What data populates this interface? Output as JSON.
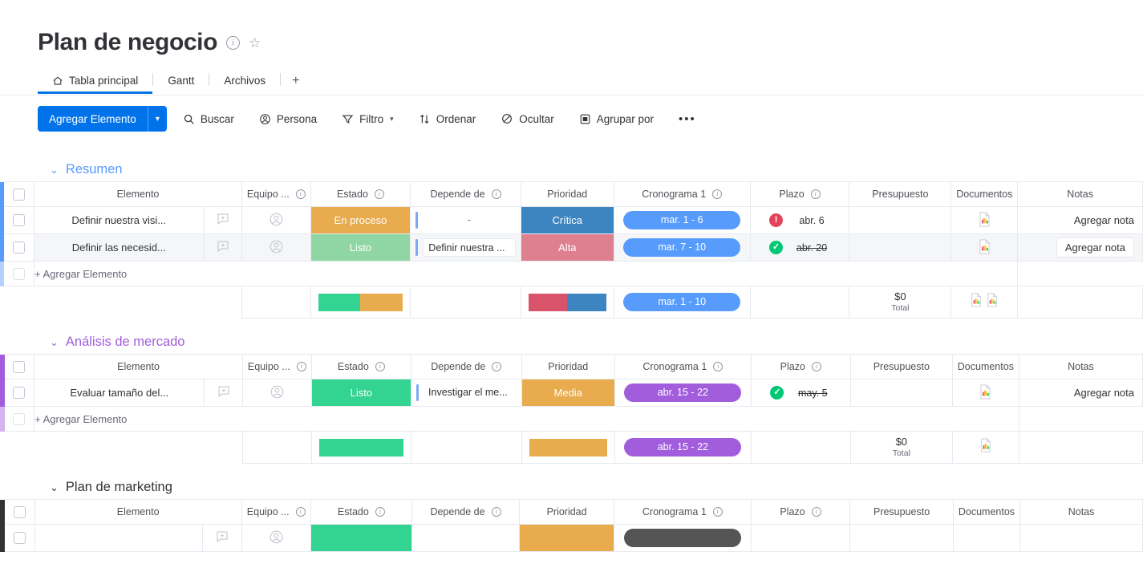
{
  "header": {
    "title": "Plan de negocio",
    "info_icon": "info-circle-icon",
    "star_icon": "star-icon"
  },
  "tabs": [
    {
      "label": "Tabla principal",
      "icon": "home-icon",
      "active": true
    },
    {
      "label": "Gantt",
      "active": false
    },
    {
      "label": "Archivos",
      "active": false
    }
  ],
  "add_tab_label": "+",
  "toolbar": {
    "add_item_label": "Agregar Elemento",
    "caret": "▾",
    "items": [
      {
        "label": "Buscar",
        "icon": "search-icon"
      },
      {
        "label": "Persona",
        "icon": "person-icon"
      },
      {
        "label": "Filtro",
        "icon": "filter-icon",
        "caret": "▾"
      },
      {
        "label": "Ordenar",
        "icon": "sort-icon"
      },
      {
        "label": "Ocultar",
        "icon": "eye-off-icon"
      },
      {
        "label": "Agrupar por",
        "icon": "group-by-icon"
      }
    ],
    "more_label": "•••"
  },
  "columns": [
    {
      "label": "Elemento",
      "info": false
    },
    {
      "label": "Equipo ...",
      "info": true
    },
    {
      "label": "Estado",
      "info": true
    },
    {
      "label": "Depende de",
      "info": true
    },
    {
      "label": "Prioridad",
      "info": false
    },
    {
      "label": "Cronograma 1",
      "info": true
    },
    {
      "label": "Plazo",
      "info": true
    },
    {
      "label": "Presupuesto",
      "info": false
    },
    {
      "label": "Documentos",
      "info": false
    },
    {
      "label": "Notas",
      "info": false
    }
  ],
  "add_item_row_label": "+ Agregar Elemento",
  "note_placeholder": "Agregar nota",
  "colors": {
    "accent_blue": "#0073ea",
    "group_resumen": "#579bfc",
    "group_analisis": "#a25ddc",
    "group_marketing": "#333333",
    "status_done": "#33d391",
    "status_done_soft": "#8fd6a4",
    "status_working": "#e8ab4e",
    "priority_critical": "#3d85c0",
    "priority_high": "#d9536a",
    "priority_high_soft": "#df8091",
    "priority_medium": "#e8ab4e",
    "timeline_blue": "#579bfc",
    "timeline_purple": "#a25ddc",
    "timeline_dark": "#555555",
    "badge_red": "#e2445c",
    "badge_green": "#00c875"
  },
  "groups": [
    {
      "name": "Resumen",
      "color": "#579bfc",
      "caret": "⌄",
      "rows": [
        {
          "name": "Definir nuestra visi...",
          "status": {
            "label": "En proceso",
            "color": "#e8ab4e"
          },
          "depends_on": "-",
          "depends_empty": true,
          "priority": {
            "label": "Crítica",
            "color": "#3d85c0"
          },
          "timeline": {
            "label": "mar. 1 - 6",
            "color": "#579bfc"
          },
          "deadline": {
            "date": "abr. 6",
            "state": "late",
            "done": false
          },
          "budget": "",
          "document": true,
          "note": "Agregar nota",
          "hover": false
        },
        {
          "name": "Definir las necesid...",
          "status": {
            "label": "Listo",
            "color": "#8fd6a4"
          },
          "depends_on": "Definir nuestra ...",
          "depends_empty": false,
          "priority": {
            "label": "Alta",
            "color": "#df8091"
          },
          "timeline": {
            "label": "mar. 7 - 10",
            "color": "#579bfc"
          },
          "deadline": {
            "date": "abr. 20",
            "state": "done",
            "done": true
          },
          "budget": "",
          "document": true,
          "note": "Agregar nota",
          "hover": true
        }
      ],
      "summary": {
        "status_segments": [
          {
            "color": "#33d391",
            "pct": 50
          },
          {
            "color": "#e8ab4e",
            "pct": 50
          }
        ],
        "priority_segments": [
          {
            "color": "#d9536a",
            "pct": 50
          },
          {
            "color": "#3d85c0",
            "pct": 50
          }
        ],
        "timeline": {
          "label": "mar. 1 - 10",
          "color": "#579bfc"
        },
        "budget_value": "$0",
        "budget_label": "Total",
        "documents_count": 2
      }
    },
    {
      "name": "Análisis de mercado",
      "color": "#a25ddc",
      "caret": "⌄",
      "rows": [
        {
          "name": "Evaluar tamaño del...",
          "status": {
            "label": "Listo",
            "color": "#33d391"
          },
          "depends_on": "Investigar el me...",
          "depends_empty": false,
          "priority": {
            "label": "Media",
            "color": "#e8ab4e"
          },
          "timeline": {
            "label": "abr. 15 - 22",
            "color": "#a25ddc"
          },
          "deadline": {
            "date": "may. 5",
            "state": "done",
            "done": true
          },
          "budget": "",
          "document": true,
          "note": "Agregar nota",
          "hover": false
        }
      ],
      "summary": {
        "status_segments": [
          {
            "color": "#33d391",
            "pct": 100
          }
        ],
        "priority_segments": [
          {
            "color": "#e8ab4e",
            "pct": 100
          }
        ],
        "timeline": {
          "label": "abr. 15 - 22",
          "color": "#a25ddc"
        },
        "budget_value": "$0",
        "budget_label": "Total",
        "documents_count": 1
      }
    },
    {
      "name": "Plan de marketing",
      "color": "#333333",
      "caret": "⌄",
      "rows": [
        {
          "name": "",
          "status": {
            "label": "",
            "color": "#33d391"
          },
          "depends_on": "",
          "depends_empty": true,
          "priority": {
            "label": "",
            "color": "#e8ab4e"
          },
          "timeline": {
            "label": "",
            "color": "#555555"
          },
          "deadline": {
            "date": "",
            "state": "done",
            "done": false
          },
          "budget": "",
          "document": false,
          "note": "",
          "hover": false
        }
      ],
      "summary": null
    }
  ]
}
